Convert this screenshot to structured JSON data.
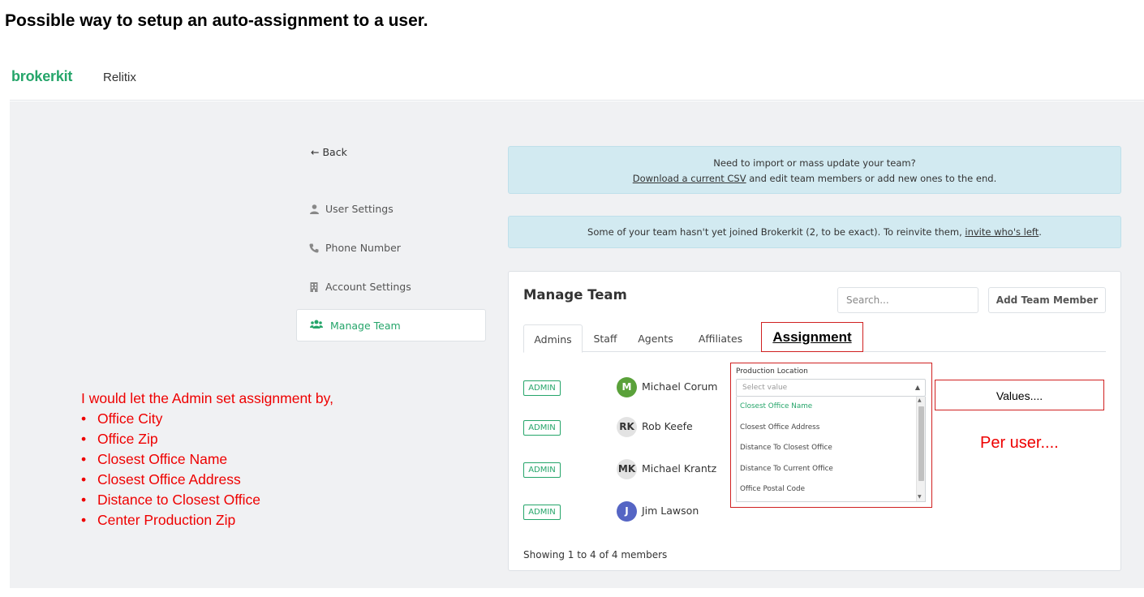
{
  "slide_title": "Possible way to setup an auto-assignment to a user.",
  "header": {
    "logo": "brokerkit",
    "org_name": "Relitix"
  },
  "sidebar": {
    "back_label": "Back",
    "items": [
      {
        "label": "User Settings",
        "icon": "user-icon"
      },
      {
        "label": "Phone Number",
        "icon": "phone-icon"
      },
      {
        "label": "Account Settings",
        "icon": "building-icon"
      },
      {
        "label": "Manage Team",
        "icon": "users-icon",
        "active": true
      }
    ]
  },
  "alerts": {
    "import_line1": "Need to import or mass update your team?",
    "import_link": "Download a current CSV",
    "import_line2_rest": " and edit team members or add new ones to the end.",
    "invite_text": "Some of your team hasn't yet joined Brokerkit (2, to be exact). To reinvite them, ",
    "invite_link": "invite who's left",
    "invite_end": "."
  },
  "manage_team": {
    "title": "Manage Team",
    "search_placeholder": "Search...",
    "add_button": "Add Team Member",
    "tabs": [
      "Admins",
      "Staff",
      "Agents",
      "Affiliates"
    ],
    "assignment_tab": "Assignment",
    "members": [
      {
        "badge": "ADMIN",
        "initials": "M",
        "name": "Michael Corum",
        "avatar_color": "#5aa13a"
      },
      {
        "badge": "ADMIN",
        "initials": "RK",
        "name": "Rob Keefe",
        "avatar_color": "#e3e3e3"
      },
      {
        "badge": "ADMIN",
        "initials": "MK",
        "name": "Michael Krantz",
        "avatar_color": "#e3e3e3"
      },
      {
        "badge": "ADMIN",
        "initials": "J",
        "name": "Jim Lawson",
        "avatar_color": "#5565c4"
      }
    ],
    "footer": "Showing 1 to 4 of 4 members"
  },
  "dropdown": {
    "label": "Production Location",
    "placeholder": "Select value",
    "options": [
      "Closest Office Name",
      "Closest Office Address",
      "Distance To Closest Office",
      "Distance To Current Office",
      "Office Postal Code"
    ],
    "selected_index": 0
  },
  "annotations": {
    "values": "Values....",
    "per_user": "Per user....",
    "intro": "I would let the Admin set assignment by,",
    "bullets": [
      "Office City",
      "Office Zip",
      "Closest Office Name",
      "Closest Office Address",
      "Distance to Closest Office",
      "Center Production Zip"
    ]
  },
  "colors": {
    "brand_green": "#25a56a",
    "annotation_red": "#e00000",
    "alert_bg": "#d2eaf1"
  }
}
